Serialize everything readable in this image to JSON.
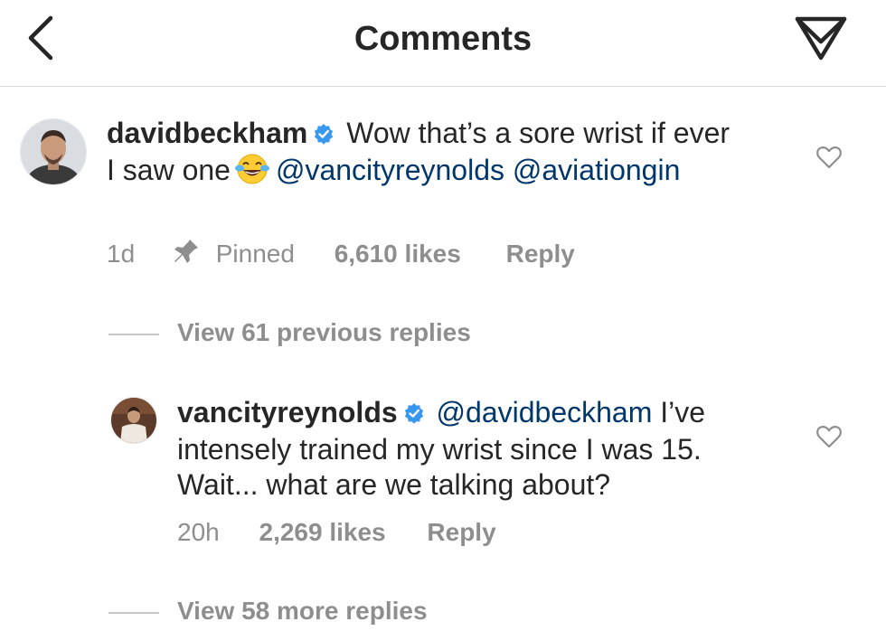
{
  "header": {
    "title": "Comments",
    "back_icon": "chevron-left-icon",
    "send_icon": "paper-plane-icon"
  },
  "comments": [
    {
      "username": "davidbeckham",
      "verified": true,
      "text_before": "Wow that’s a sore wrist if ever I saw one",
      "emoji": "😂",
      "mentions": [
        "@vancityreynolds",
        "@aviationgin"
      ],
      "time": "1d",
      "pinned_label": "Pinned",
      "likes": "6,610 likes",
      "reply_label": "Reply",
      "replies_toggle": "View 61 previous replies"
    },
    {
      "username": "vancityreynolds",
      "verified": true,
      "mention": "@davidbeckham",
      "text_after": "I’ve intensely trained my wrist since I was 15. Wait... what are we talking about?",
      "time": "20h",
      "likes": "2,269 likes",
      "reply_label": "Reply",
      "replies_toggle": "View 58 more replies"
    }
  ],
  "colors": {
    "text": "#262626",
    "secondary": "#8e8e8e",
    "mention": "#00376b",
    "verified": "#3897f0",
    "divider": "#dbdbdb"
  }
}
